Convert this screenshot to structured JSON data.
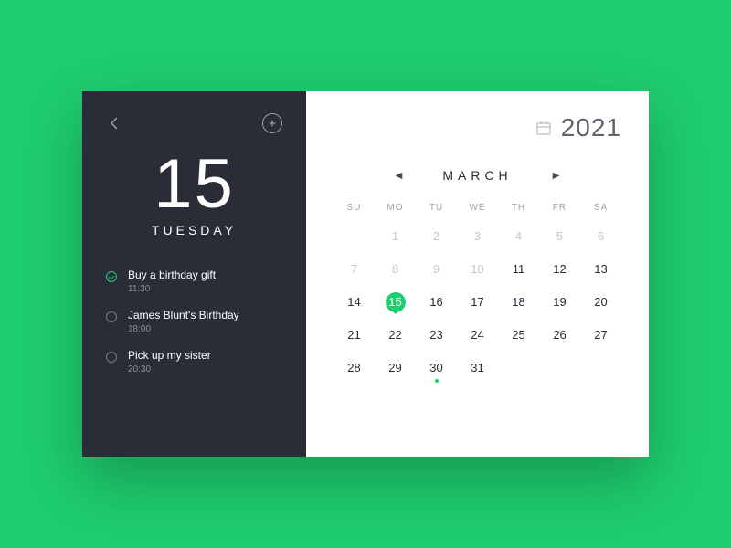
{
  "accent": "#1ecd6e",
  "left": {
    "day_number": "15",
    "weekday": "TUESDAY",
    "tasks": [
      {
        "title": "Buy a birthday gift",
        "time": "11:30",
        "done": true
      },
      {
        "title": "James Blunt's Birthday",
        "time": "18:00",
        "done": false
      },
      {
        "title": "Pick up my sister",
        "time": "20:30",
        "done": false
      }
    ]
  },
  "right": {
    "year": "2021",
    "month": "MARCH",
    "weekdays": [
      "SU",
      "MO",
      "TU",
      "WE",
      "TH",
      "FR",
      "SA"
    ],
    "leading_blanks": 1,
    "days_in_month": 31,
    "dim_days": [
      1,
      2,
      3,
      4,
      5,
      6,
      7,
      8,
      9,
      10
    ],
    "selected": 15,
    "dotted": [
      30
    ]
  }
}
